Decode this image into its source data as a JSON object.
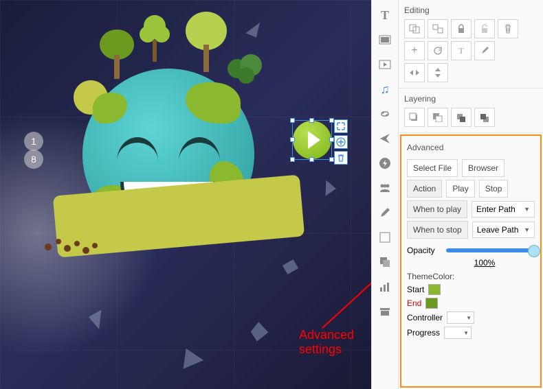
{
  "markers": {
    "m1": "1",
    "m2": "8"
  },
  "annotation": "Advanced settings",
  "panels": {
    "editing_title": "Editing",
    "layering_title": "Layering",
    "advanced_title": "Advanced",
    "select_file": "Select File",
    "browser": "Browser",
    "action": "Action",
    "play": "Play",
    "stop": "Stop",
    "when_to_play": "When to play",
    "when_to_play_value": "Enter Path",
    "when_to_stop": "When to stop",
    "when_to_stop_value": "Leave Path",
    "opacity": "Opacity",
    "opacity_value": "100%",
    "theme_color": "ThemeColor:",
    "start": "Start",
    "end": "End",
    "controller": "Controller",
    "progress": "Progress",
    "colors": {
      "start": "#8ab82e",
      "end": "#6a9a1e"
    }
  }
}
